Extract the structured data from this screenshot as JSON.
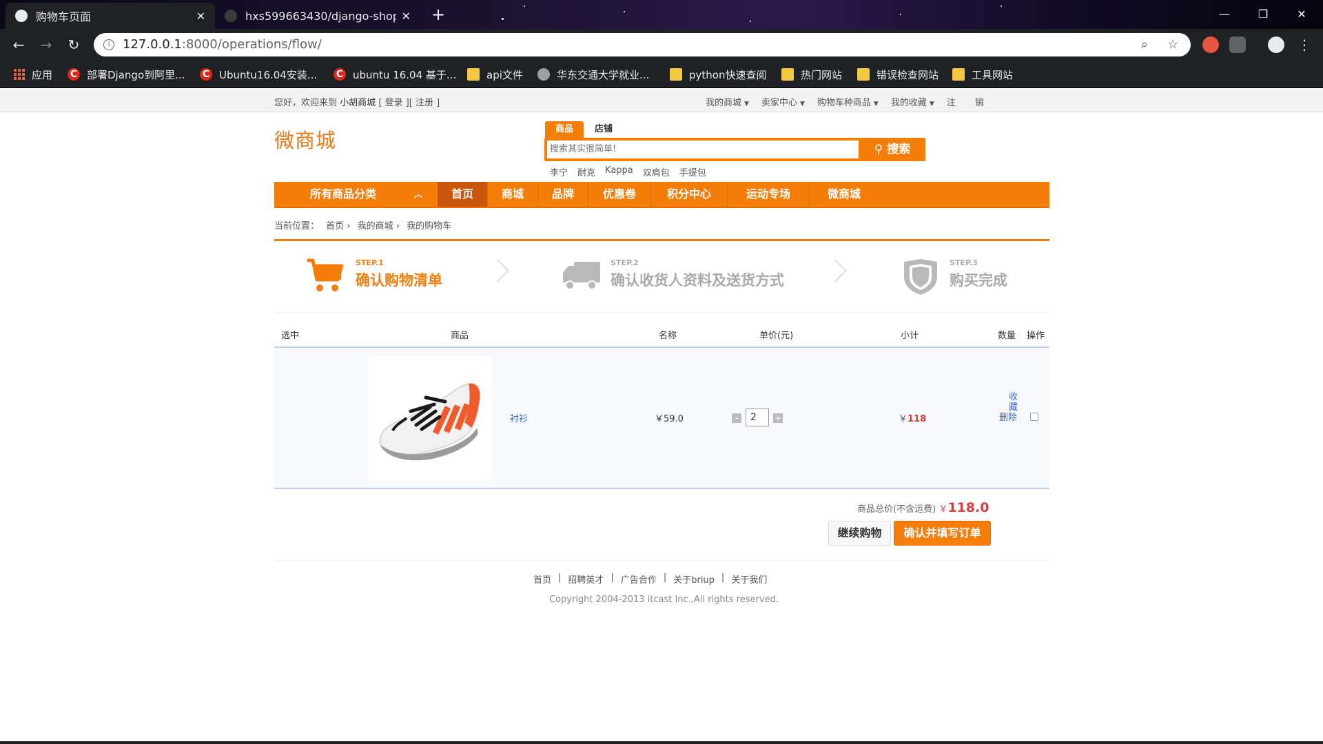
{
  "browser": {
    "tabs": [
      {
        "title": "购物车页面",
        "active": true
      },
      {
        "title": "hxs599663430/django-shoppi",
        "active": false
      }
    ],
    "url_host": "127.0.0.1",
    "url_path": ":8000/operations/flow/",
    "window_controls": {
      "minimize": "—",
      "restore": "❐",
      "close": "✕"
    },
    "bookmarks": [
      {
        "label": "应用",
        "icon": "apps-grid-icon"
      },
      {
        "label": "部署Django到阿里...",
        "icon": "csdn-icon"
      },
      {
        "label": "Ubuntu16.04安装...",
        "icon": "csdn-icon"
      },
      {
        "label": "ubuntu 16.04 基于...",
        "icon": "csdn-icon"
      },
      {
        "label": "api文件",
        "icon": "folder-icon"
      },
      {
        "label": "华东交通大学就业...",
        "icon": "globe-icon"
      },
      {
        "label": "python快速查阅",
        "icon": "folder-icon"
      },
      {
        "label": "热门网站",
        "icon": "folder-icon"
      },
      {
        "label": "错误检查网站",
        "icon": "folder-icon"
      },
      {
        "label": "工具网站",
        "icon": "folder-icon"
      }
    ]
  },
  "topbar": {
    "welcome": "您好，欢迎来到",
    "shop_name": "小胡商城",
    "login_open": "[",
    "login": "登录",
    "mid": "][",
    "register": "注册",
    "login_close": "]",
    "links": [
      "我的商城",
      "卖家中心",
      "购物车种商品",
      "我的收藏"
    ],
    "logout_a": "注",
    "logout_b": "销"
  },
  "header": {
    "logo": "微商城",
    "search_tabs": [
      "商品",
      "店铺"
    ],
    "search_placeholder": "搜索其实很简单!",
    "search_button": "搜索",
    "hot_words": [
      "李宁",
      "耐克",
      "Kappa",
      "双肩包",
      "手提包"
    ]
  },
  "nav": {
    "all_categories": "所有商品分类",
    "items": [
      "首页",
      "商城",
      "品牌",
      "优惠卷",
      "积分中心",
      "运动专场",
      "微商城"
    ],
    "active_index": 0
  },
  "breadcrumb": {
    "prefix": "当前位置：",
    "items": [
      "首页 ›",
      "我的商城 ›",
      "我的购物车"
    ]
  },
  "steps": [
    {
      "no": "STEP.1",
      "title": "确认购物清单",
      "icon": "cart-icon",
      "active": true
    },
    {
      "no": "STEP.2",
      "title": "确认收货人资料及送货方式",
      "icon": "truck-icon",
      "active": false
    },
    {
      "no": "STEP.3",
      "title": "购买完成",
      "icon": "shield-icon",
      "active": false
    }
  ],
  "table": {
    "headers": [
      "选中",
      "商品",
      "名称",
      "单价(元)",
      "小计",
      "数量",
      "操作"
    ],
    "rows": [
      {
        "name": "衬衫",
        "price": "￥59.0",
        "quantity": "2",
        "minus": "-",
        "plus": "+",
        "subtotal_cur": "￥",
        "subtotal": "118",
        "op_collect": "收藏",
        "op_delete": "删除",
        "selected": false
      }
    ]
  },
  "summary": {
    "label": "商品总价(不含运费)",
    "currency": "￥",
    "total": "118.0",
    "continue_label": "继续购物",
    "confirm_label": "确认并填写订单"
  },
  "footer": {
    "links": [
      "首页",
      "招聘英才",
      "广告合作",
      "关于briup",
      "关于我们"
    ],
    "separator": "|",
    "copyright": "Copyright 2004-2013 itcast Inc.,All rights reserved."
  },
  "colors": {
    "accent": "#f57d0a",
    "price_red": "#e4393c",
    "link_blue": "#3366cc"
  }
}
